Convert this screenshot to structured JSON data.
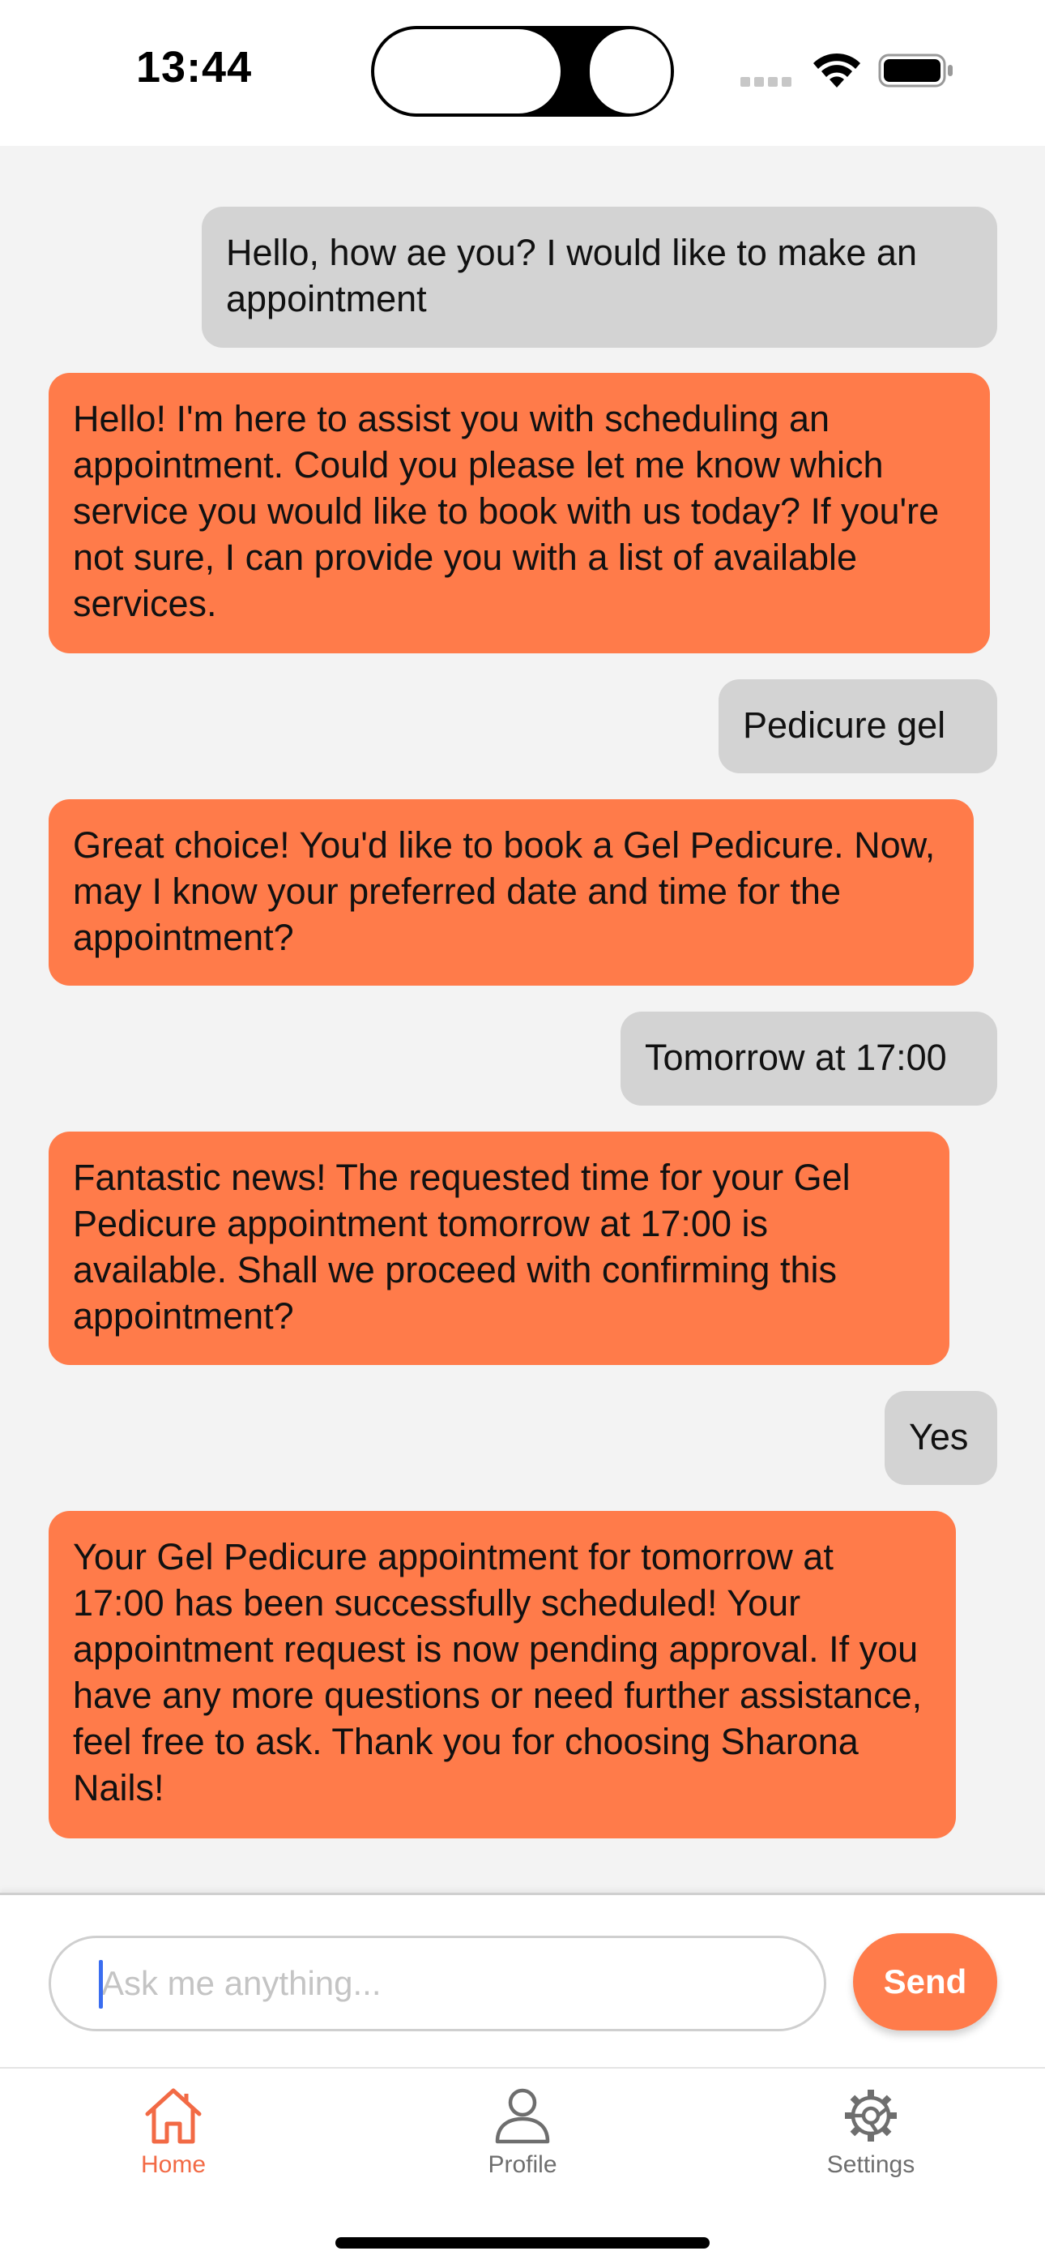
{
  "status_bar": {
    "time": "13:44",
    "icons": [
      "signal-icon",
      "wifi-icon",
      "battery-icon"
    ]
  },
  "chat": {
    "messages": [
      {
        "sender": "user",
        "text": "Hello, how ae you? I would like to make an appointment"
      },
      {
        "sender": "assistant",
        "text": "Hello! I'm here to assist you with scheduling an appointment. Could you please let me know which service you would like to book with us today? If you're not sure, I can provide you with a list of available services."
      },
      {
        "sender": "user",
        "text": "Pedicure gel"
      },
      {
        "sender": "assistant",
        "text": "Great choice! You'd like to book a Gel Pedicure. Now, may I know your preferred date and time for the appointment?"
      },
      {
        "sender": "user",
        "text": "Tomorrow at 17:00"
      },
      {
        "sender": "assistant",
        "text": "Fantastic news! The requested time for your Gel Pedicure appointment tomorrow at 17:00 is available. Shall we proceed with confirming this appointment?"
      },
      {
        "sender": "user",
        "text": "Yes"
      },
      {
        "sender": "assistant",
        "text": "Your Gel Pedicure appointment for tomorrow at 17:00 has been successfully scheduled! Your appointment request is now pending approval. If you have any more questions or need further assistance, feel free to ask. Thank you for choosing Sharona Nails!"
      }
    ]
  },
  "composer": {
    "value": "",
    "placeholder": "Ask me anything...",
    "send_label": "Send"
  },
  "tabs": [
    {
      "label": "Home",
      "icon": "home-icon",
      "active": true
    },
    {
      "label": "Profile",
      "icon": "person-icon",
      "active": false
    },
    {
      "label": "Settings",
      "icon": "gear-icon",
      "active": false
    }
  ],
  "colors": {
    "accent": "#ff7b4a",
    "user_bubble": "#d3d3d3",
    "chat_background": "#f3f3f3",
    "tab_active": "#f26a45",
    "tab_inactive": "#6e6e6e"
  }
}
